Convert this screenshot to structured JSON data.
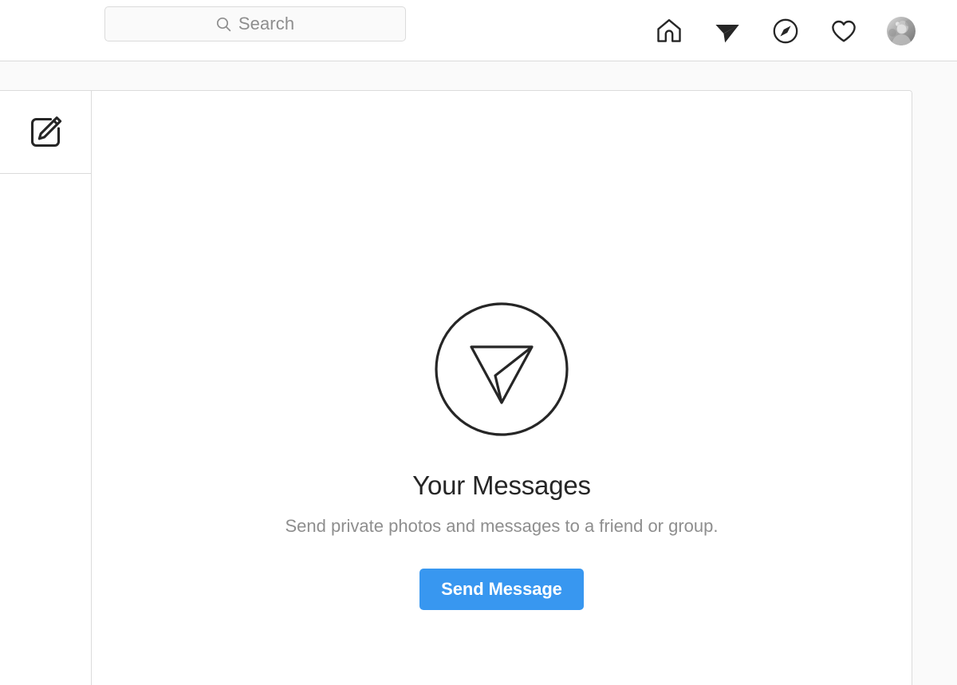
{
  "header": {
    "search": {
      "placeholder": "Search",
      "value": "",
      "icon": "search-icon"
    },
    "nav_items": [
      {
        "name": "home-icon",
        "label": "Home",
        "active": false
      },
      {
        "name": "direct-icon",
        "label": "Direct",
        "active": true
      },
      {
        "name": "explore-icon",
        "label": "Explore",
        "active": false
      },
      {
        "name": "activity-heart-icon",
        "label": "Activity",
        "active": false
      },
      {
        "name": "profile-avatar",
        "label": "Profile",
        "active": false
      }
    ]
  },
  "sidebar": {
    "compose_label": "New Message",
    "compose_icon": "compose-pencil-icon",
    "threads": []
  },
  "main": {
    "empty_state": {
      "icon": "direct-circle-icon",
      "title": "Your Messages",
      "subtitle": "Send private photos and messages to a friend or group.",
      "button_label": "Send Message"
    }
  },
  "colors": {
    "accent_blue": "#3897f0",
    "text_primary": "#262626",
    "text_secondary": "#8e8e8e",
    "border": "#dbdbdb",
    "page_background": "#fafafa",
    "surface": "#ffffff"
  }
}
